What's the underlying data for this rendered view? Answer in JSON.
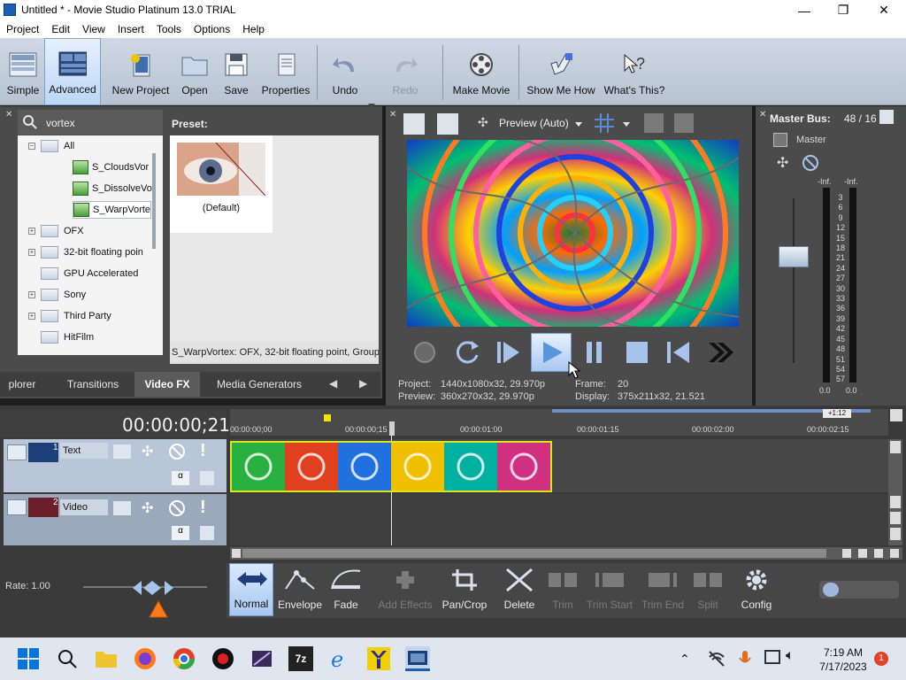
{
  "titlebar": {
    "title": "Untitled * - Movie Studio Platinum 13.0 TRIAL",
    "minimize": "—",
    "maximize": "❐",
    "close": "✕"
  },
  "menu": [
    "Project",
    "Edit",
    "View",
    "Insert",
    "Tools",
    "Options",
    "Help"
  ],
  "toolbar": {
    "simple": "Simple",
    "advanced": "Advanced",
    "new_project": "New Project",
    "open": "Open",
    "save": "Save",
    "properties": "Properties",
    "undo": "Undo",
    "redo": "Redo",
    "make_movie": "Make Movie",
    "show_me_how": "Show Me How",
    "whats_this": "What's This?"
  },
  "explorer": {
    "search_value": "vortex",
    "tree": [
      {
        "label": "All",
        "kind": "folder",
        "expander": "−"
      },
      {
        "label": "S_CloudsVor",
        "kind": "fx"
      },
      {
        "label": "S_DissolveVo",
        "kind": "fx"
      },
      {
        "label": "S_WarpVorte",
        "kind": "fx"
      },
      {
        "label": "OFX",
        "kind": "folder",
        "expander": "+"
      },
      {
        "label": "32-bit floating poin",
        "kind": "folder",
        "expander": "+"
      },
      {
        "label": "GPU Accelerated",
        "kind": "folder",
        "expander": ""
      },
      {
        "label": "Sony",
        "kind": "folder",
        "expander": "+"
      },
      {
        "label": "Third Party",
        "kind": "folder",
        "expander": "+"
      },
      {
        "label": "HitFilm",
        "kind": "folder",
        "expander": ""
      }
    ],
    "preset_title": "Preset:",
    "preset_default": "(Default)",
    "status": "S_WarpVortex: OFX, 32-bit floating point, Group",
    "tabs": [
      "plorer",
      "Transitions",
      "Video FX",
      "Media Generators"
    ]
  },
  "preview": {
    "mode_label": "Preview (Auto)",
    "project_label": "Project:",
    "project_value": "1440x1080x32, 29.970p",
    "preview_label": "Preview:",
    "preview_value": "360x270x32, 29.970p",
    "frame_label": "Frame:",
    "frame_value": "20",
    "display_label": "Display:",
    "display_value": "375x211x32, 21.521"
  },
  "master": {
    "title": "Master Bus:",
    "value": "48 / 16",
    "label": "Master",
    "inf_left": "-Inf.",
    "inf_right": "-Inf.",
    "scale": [
      "3",
      "6",
      "9",
      "12",
      "15",
      "18",
      "21",
      "24",
      "27",
      "30",
      "33",
      "36",
      "39",
      "42",
      "45",
      "48",
      "51",
      "54",
      "57"
    ],
    "zero_left": "0.0",
    "zero_right": "0.0"
  },
  "timeline": {
    "timecode": "00:00:00;21",
    "ruler": [
      "00:00:00;00",
      "00:00:00;15",
      "00:00:01:00",
      "00:00:01:15",
      "00:00:02:00",
      "00:00:02:15"
    ],
    "zoom": "+1:12",
    "tracks": [
      {
        "number": "1",
        "name": "Text"
      },
      {
        "number": "2",
        "name": "Video"
      }
    ],
    "rate_label": "Rate: 1.00"
  },
  "bottom_tools": {
    "normal": "Normal",
    "envelope": "Envelope",
    "fade": "Fade",
    "add_effects": "Add Effects",
    "pan_crop": "Pan/Crop",
    "delete": "Delete",
    "trim": "Trim",
    "trim_start": "Trim Start",
    "trim_end": "Trim End",
    "split": "Split",
    "config": "Config"
  },
  "taskbar": {
    "time": "7:19 AM",
    "date": "7/17/2023",
    "notification_count": "1",
    "fz": "7z"
  }
}
